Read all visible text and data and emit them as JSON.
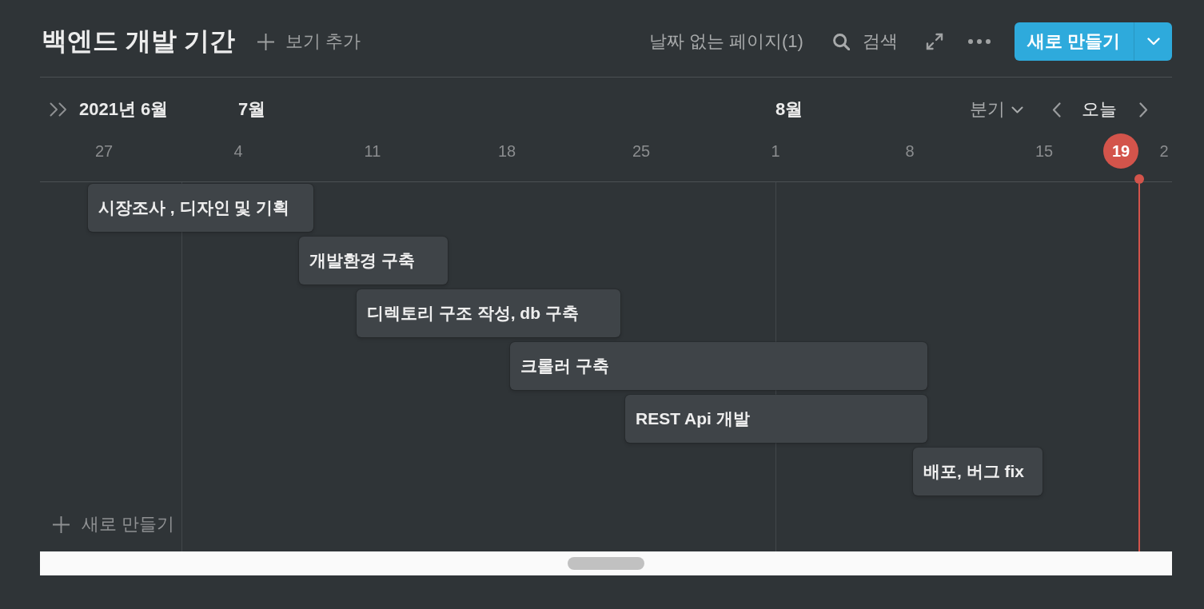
{
  "header": {
    "title": "백엔드 개발 기간",
    "add_view": "보기 추가",
    "toolbar": [
      {
        "kind": "text",
        "label": "날짜 없는 페이지(1)"
      },
      {
        "kind": "search",
        "label": "검색"
      },
      {
        "kind": "expand"
      },
      {
        "kind": "more"
      }
    ],
    "new_button": "새로 만들기"
  },
  "timeline": {
    "current_month": "2021년 6월",
    "scale": "분기",
    "today_button": "오늘",
    "days": [
      {
        "label": "27",
        "today": false
      },
      {
        "label": "4",
        "month": "7월",
        "today": false
      },
      {
        "label": "11",
        "today": false
      },
      {
        "label": "18",
        "today": false
      },
      {
        "label": "25",
        "today": false
      },
      {
        "label": "1",
        "month": "8월",
        "today": false
      },
      {
        "label": "8",
        "today": false
      },
      {
        "label": "15",
        "today": false
      },
      {
        "label": "19",
        "today": true
      },
      {
        "label": "2",
        "today": false
      }
    ]
  },
  "items": [
    {
      "title": "시장조사 , 디자인 및 기획"
    },
    {
      "title": "개발환경 구축"
    },
    {
      "title": "디렉토리 구조 작성, db 구축"
    },
    {
      "title": "크롤러 구축"
    },
    {
      "title": "REST Api 개발"
    },
    {
      "title": "배포, 버그 fix"
    }
  ],
  "new_row": "새로 만들기"
}
